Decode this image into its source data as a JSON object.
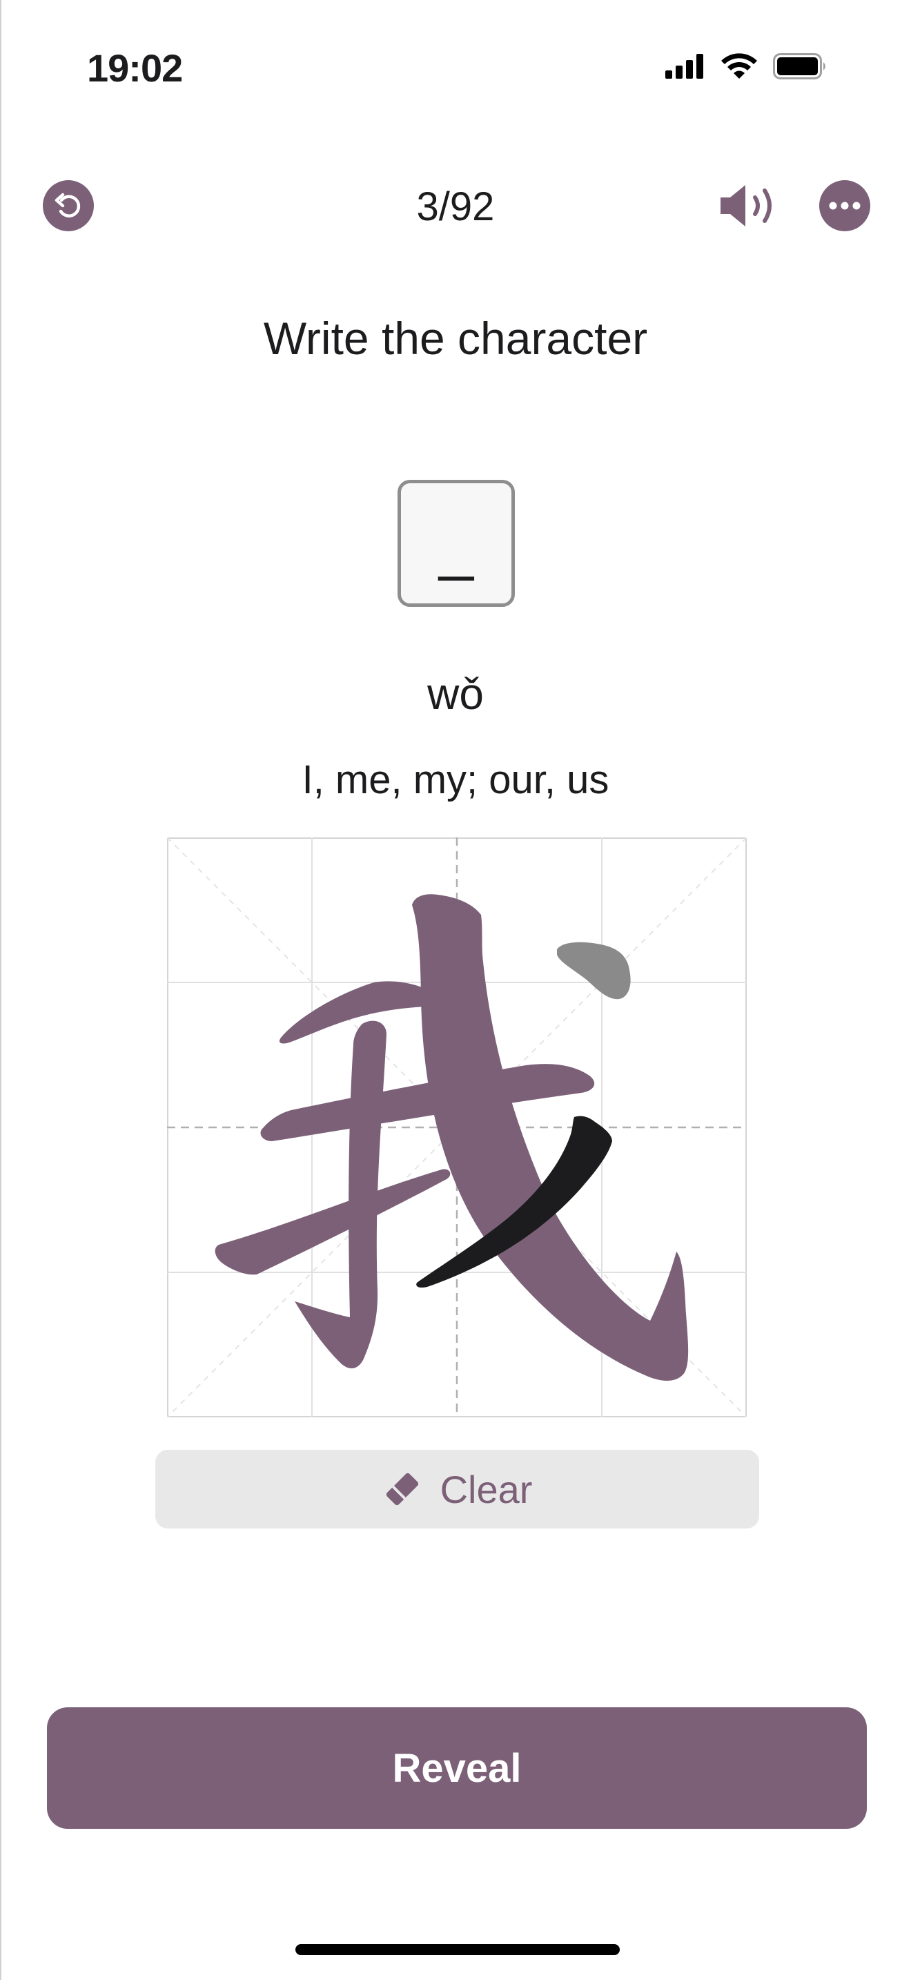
{
  "status_bar": {
    "time": "19:02",
    "icons": [
      "cellular-signal-icon",
      "wifi-icon",
      "battery-icon"
    ]
  },
  "header": {
    "back_icon": "undo-arrow-icon",
    "progress": "3/92",
    "audio_icon": "speaker-icon",
    "more_icon": "more-dots-icon"
  },
  "prompt": {
    "title": "Write the character",
    "answer_placeholder": "_",
    "pinyin": "wǒ",
    "meaning": "I, me, my; our, us"
  },
  "writing_grid": {
    "character": "我",
    "stroke_color": "#7b6078",
    "hint_stroke_color": "#8a8a8a",
    "active_stroke_color": "#1c1c1e"
  },
  "clear_button": {
    "icon": "eraser-icon",
    "label": "Clear"
  },
  "reveal_button": {
    "label": "Reveal"
  },
  "colors": {
    "accent": "#7b6078",
    "button_gray": "#e8e8e8"
  }
}
